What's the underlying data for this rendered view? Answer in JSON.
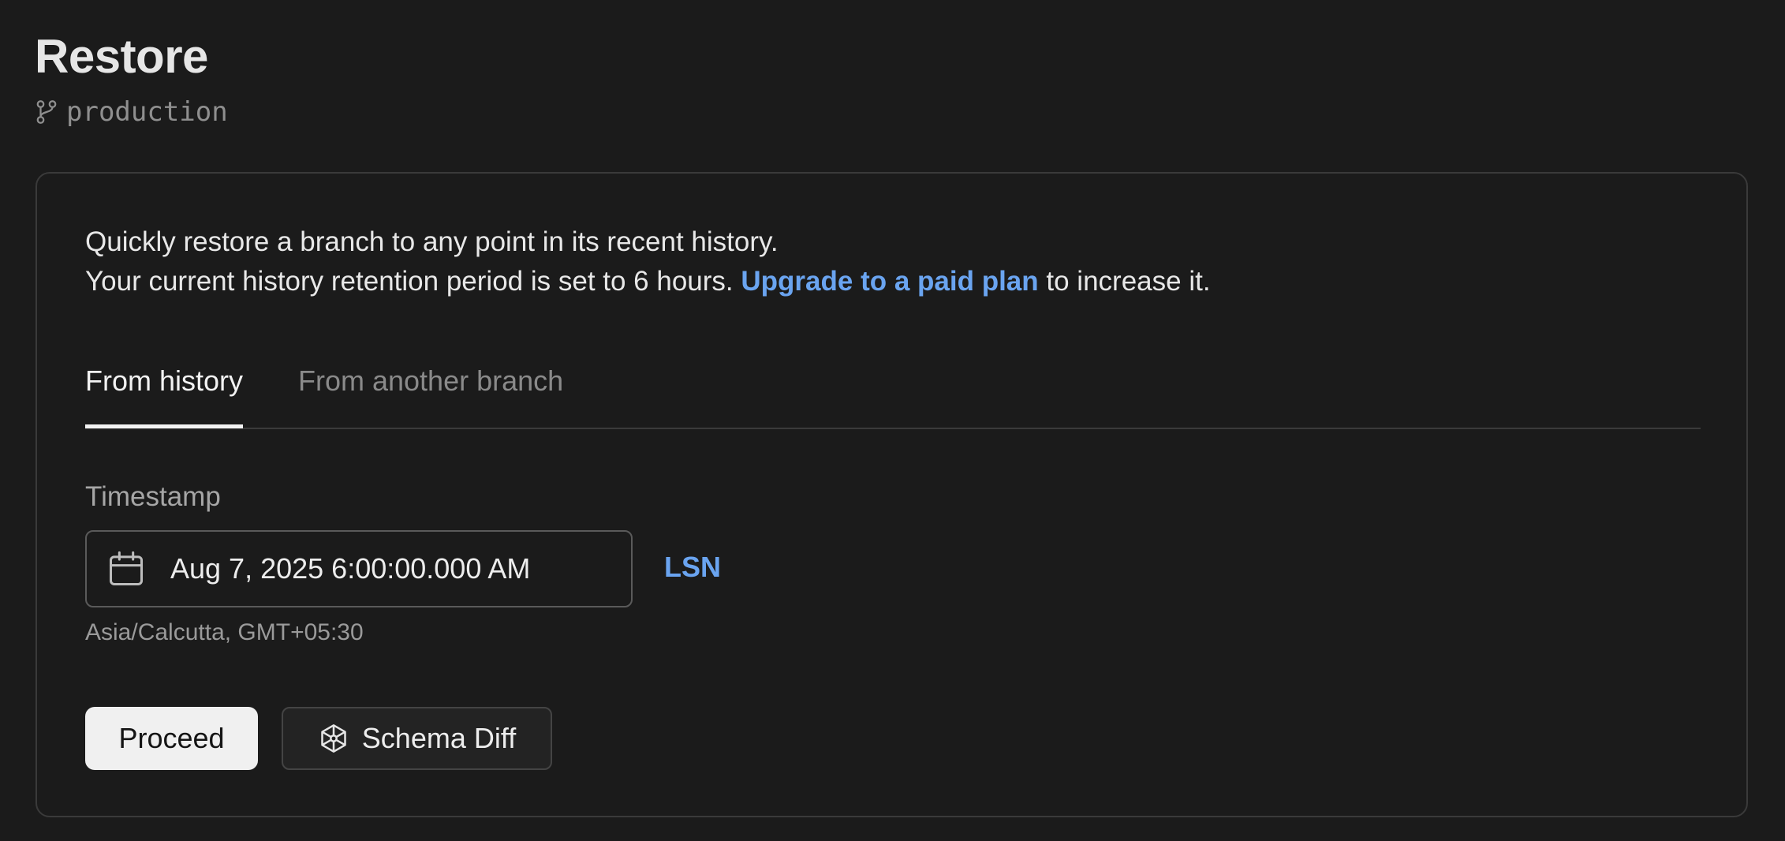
{
  "header": {
    "title": "Restore",
    "branch": "production",
    "branch_icon": "git-branch-icon"
  },
  "card": {
    "description_line1": "Quickly restore a branch to any point in its recent history.",
    "description_line2_prefix": "Your current history retention period is set to 6 hours.",
    "upgrade_link": "Upgrade to a paid plan",
    "description_line2_suffix": "to increase it.",
    "tabs": [
      {
        "label": "From history",
        "active": true
      },
      {
        "label": "From another branch",
        "active": false
      }
    ],
    "timestamp": {
      "label": "Timestamp",
      "value": "Aug 7, 2025 6:00:00.000 AM",
      "icon": "calendar-icon",
      "timezone": "Asia/Calcutta, GMT+05:30"
    },
    "lsn_link": "LSN",
    "buttons": {
      "proceed": "Proceed",
      "schema_diff": "Schema Diff",
      "schema_diff_icon": "schema-diff-icon"
    }
  },
  "colors": {
    "background": "#1b1b1b",
    "link": "#6aa4f0",
    "primary_button": "#f0f0f0"
  }
}
